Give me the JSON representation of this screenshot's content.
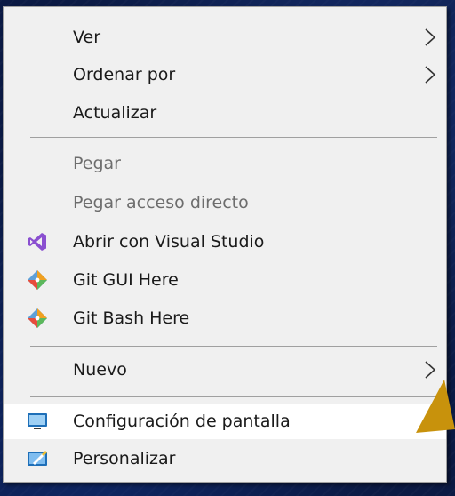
{
  "context_menu": {
    "items": [
      {
        "label": "Ver",
        "has_submenu": true
      },
      {
        "label": "Ordenar por",
        "has_submenu": true
      },
      {
        "label": "Actualizar"
      },
      {
        "label": "Pegar",
        "disabled": true
      },
      {
        "label": "Pegar acceso directo",
        "disabled": true
      },
      {
        "label": "Abrir con Visual Studio",
        "icon": "visual-studio-icon"
      },
      {
        "label": "Git GUI Here",
        "icon": "git-icon"
      },
      {
        "label": "Git Bash Here",
        "icon": "git-icon"
      },
      {
        "label": "Nuevo",
        "has_submenu": true
      },
      {
        "label": "Configuración de pantalla",
        "icon": "display-settings-icon",
        "highlighted": true
      },
      {
        "label": "Personalizar",
        "icon": "personalize-icon"
      }
    ]
  },
  "colors": {
    "menu_bg": "#f0f0f0",
    "highlight_bg": "#ffffff",
    "text": "#1a1a1a",
    "disabled_text": "#6d6d6d",
    "visual_studio": "#8a4fd0",
    "cursor_arrow": "#c8920c"
  }
}
